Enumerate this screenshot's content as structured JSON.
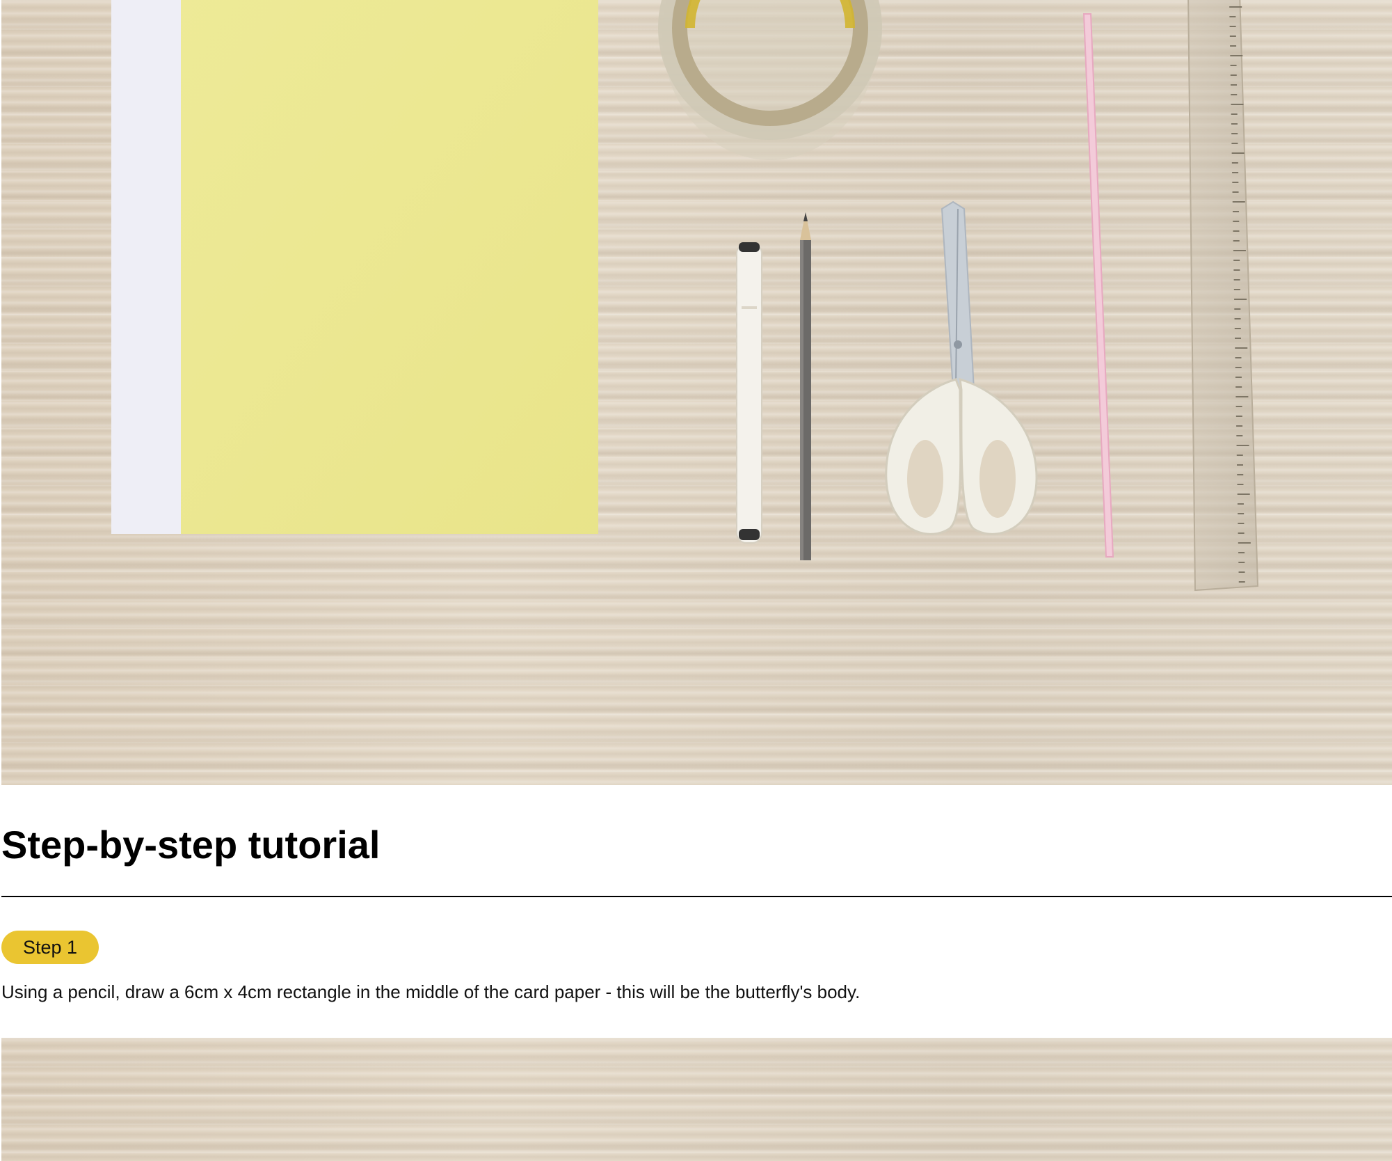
{
  "hero_image": {
    "alt": "",
    "items": [
      "white-paper",
      "yellow-card-paper",
      "tape-roll",
      "marker",
      "pencil",
      "scissors",
      "straw",
      "ruler"
    ]
  },
  "tutorial": {
    "title": "Step-by-step tutorial",
    "steps": [
      {
        "badge": "Step 1",
        "text": "Using a pencil, draw a 6cm x 4cm rectangle in the middle of the card paper - this will be the butterfly's body."
      }
    ]
  },
  "colors": {
    "badge_bg": "#eac531",
    "wood": "#e2d6c4",
    "yellow_paper": "#ece88e"
  }
}
